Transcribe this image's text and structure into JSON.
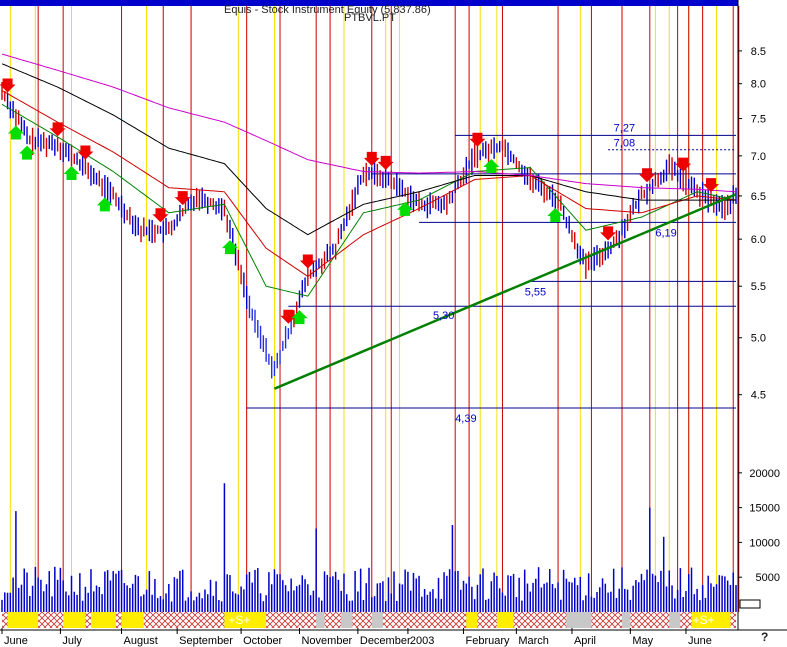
{
  "header": {
    "title": "Equis - Stock Instrument Equity (5,837.86)",
    "symbol": "PTBVL.PT",
    "help_mark": "?"
  },
  "chart_data": {
    "type": "line",
    "title": "Equis - Stock Instrument Equity (5,837.86)",
    "subtitle": "PTBVL.PT",
    "xlabel": "",
    "ylabel": "",
    "x_tick_labels": [
      "June",
      "July",
      "August",
      "September",
      "October",
      "November",
      "December",
      "2003",
      "February",
      "March",
      "April",
      "May",
      "June"
    ],
    "price_axis": {
      "scale": "log",
      "ylim": [
        4.1,
        9.0
      ],
      "ticks": [
        4.5,
        5.0,
        5.5,
        6.0,
        6.5,
        7.0,
        7.5,
        8.0,
        8.5
      ]
    },
    "volume_axis": {
      "ylim": [
        0,
        24000
      ],
      "ticks": [
        5000,
        10000,
        15000,
        20000
      ]
    },
    "price_annotations": [
      {
        "label": "7,27",
        "value": 7.27
      },
      {
        "label": "7,08",
        "value": 7.08
      },
      {
        "label": "6,19",
        "value": 6.19
      },
      {
        "label": "5,55",
        "value": 5.55
      },
      {
        "label": "5,30",
        "value": 5.3
      },
      {
        "label": "4,39",
        "value": 4.39
      }
    ],
    "horizontal_levels": [
      7.27,
      7.08,
      6.77,
      6.19,
      5.55,
      5.3,
      4.39
    ],
    "trendline": {
      "start": {
        "x": 98,
        "y": 4.55
      },
      "end": {
        "x": 264,
        "y": 6.52
      },
      "color": "#008000"
    },
    "series": [
      {
        "name": "",
        "x": [
          0,
          10,
          20,
          30,
          40,
          50,
          60,
          70,
          80,
          90,
          98,
          110,
          120,
          130,
          140,
          150,
          160,
          170,
          180,
          190,
          200,
          210,
          220,
          230,
          240,
          250,
          260,
          264
        ],
        "values": [
          7.9,
          7.2,
          7.15,
          6.85,
          6.5,
          6.1,
          6.1,
          6.5,
          6.35,
          5.2,
          4.7,
          5.6,
          5.9,
          6.8,
          6.7,
          6.4,
          6.4,
          7.0,
          7.15,
          6.7,
          6.45,
          5.7,
          5.95,
          6.5,
          6.85,
          6.55,
          6.35,
          6.5
        ]
      },
      {
        "name": "",
        "x": [
          0,
          20,
          40,
          60,
          80,
          95,
          110,
          130,
          150,
          170,
          190,
          210,
          230,
          250,
          264
        ],
        "values": [
          7.7,
          7.25,
          6.8,
          6.3,
          6.4,
          5.5,
          5.4,
          6.3,
          6.45,
          6.8,
          6.85,
          6.1,
          6.25,
          6.55,
          6.45
        ]
      },
      {
        "name": "",
        "x": [
          0,
          20,
          40,
          60,
          80,
          95,
          110,
          130,
          150,
          170,
          190,
          210,
          230,
          250,
          264
        ],
        "values": [
          7.9,
          7.45,
          7.05,
          6.6,
          6.55,
          5.9,
          5.6,
          6.05,
          6.35,
          6.7,
          6.75,
          6.35,
          6.3,
          6.5,
          6.45
        ]
      },
      {
        "name": "",
        "x": [
          0,
          20,
          40,
          60,
          80,
          95,
          110,
          130,
          150,
          170,
          190,
          210,
          230,
          250,
          264
        ],
        "values": [
          8.3,
          7.95,
          7.55,
          7.1,
          6.9,
          6.35,
          6.05,
          6.4,
          6.55,
          6.75,
          6.75,
          6.55,
          6.45,
          6.45,
          6.45
        ]
      },
      {
        "name": "",
        "x": [
          0,
          20,
          40,
          60,
          80,
          95,
          110,
          130,
          150,
          170,
          190,
          210,
          230,
          250,
          264
        ],
        "values": [
          8.45,
          8.2,
          7.95,
          7.65,
          7.45,
          7.2,
          6.95,
          6.8,
          6.78,
          6.8,
          6.75,
          6.65,
          6.6,
          6.58,
          6.55
        ]
      }
    ],
    "vertical_markers_red_x": [
      13,
      22,
      43,
      58,
      68,
      88,
      100,
      113,
      118,
      133,
      140,
      163,
      168,
      180,
      200,
      212,
      223,
      233,
      243,
      247,
      252,
      263,
      265
    ],
    "vertical_markers_yellow_x": [
      3,
      12,
      25,
      52,
      68,
      85,
      98,
      123,
      138,
      143,
      172,
      178,
      208,
      235,
      240,
      247,
      257
    ],
    "volume_spikes": [
      {
        "x": 5,
        "value": 14500
      },
      {
        "x": 80,
        "value": 18500
      },
      {
        "x": 113,
        "value": 12000
      },
      {
        "x": 162,
        "value": 12500
      },
      {
        "x": 233,
        "value": 15000
      },
      {
        "x": 238,
        "value": 10800
      }
    ],
    "signal_arrows": {
      "down_x": [
        2,
        20,
        30,
        57,
        65,
        103,
        110,
        133,
        138,
        171,
        218,
        232,
        245,
        255
      ],
      "up_x": [
        5,
        9,
        25,
        37,
        82,
        107,
        145,
        176,
        199
      ]
    },
    "band_labels": [
      "+S+",
      "+S+"
    ],
    "grid": false,
    "legend": "none"
  }
}
